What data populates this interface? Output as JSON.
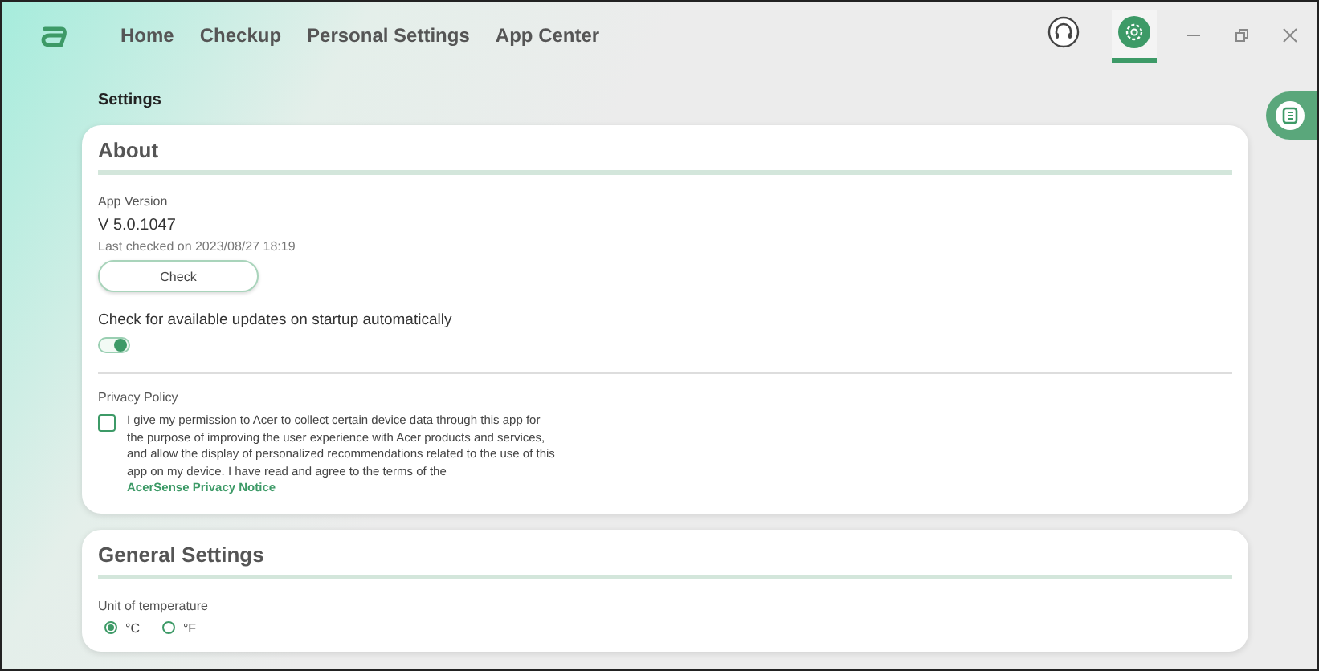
{
  "nav": {
    "items": [
      {
        "label": "Home",
        "selected": false
      },
      {
        "label": "Checkup",
        "selected": false
      },
      {
        "label": "Personal Settings",
        "selected": false
      },
      {
        "label": "App Center",
        "selected": false
      }
    ]
  },
  "toolbar": {
    "settings_selected": true
  },
  "page_title": "Settings",
  "about": {
    "title": "About",
    "version_label": "App Version",
    "version": "V 5.0.1047",
    "last_checked": "Last checked on 2023/08/27 18:19",
    "check_button": "Check",
    "auto_update": {
      "label": "Check for available updates on startup automatically",
      "on": true
    },
    "privacy": {
      "title": "Privacy Policy",
      "checked": false,
      "text": "I give my permission to Acer to collect certain device data through this app for the purpose of improving the user experience with Acer products and services, and allow the display of personalized recommendations related to the use of this app on my device. I have read and agree to the terms of the",
      "link": "AcerSense Privacy Notice"
    }
  },
  "general": {
    "title": "General Settings",
    "temperature_label": "Unit of temperature",
    "units": [
      {
        "label": "°C",
        "selected": true
      },
      {
        "label": "°F",
        "selected": false
      }
    ]
  }
}
